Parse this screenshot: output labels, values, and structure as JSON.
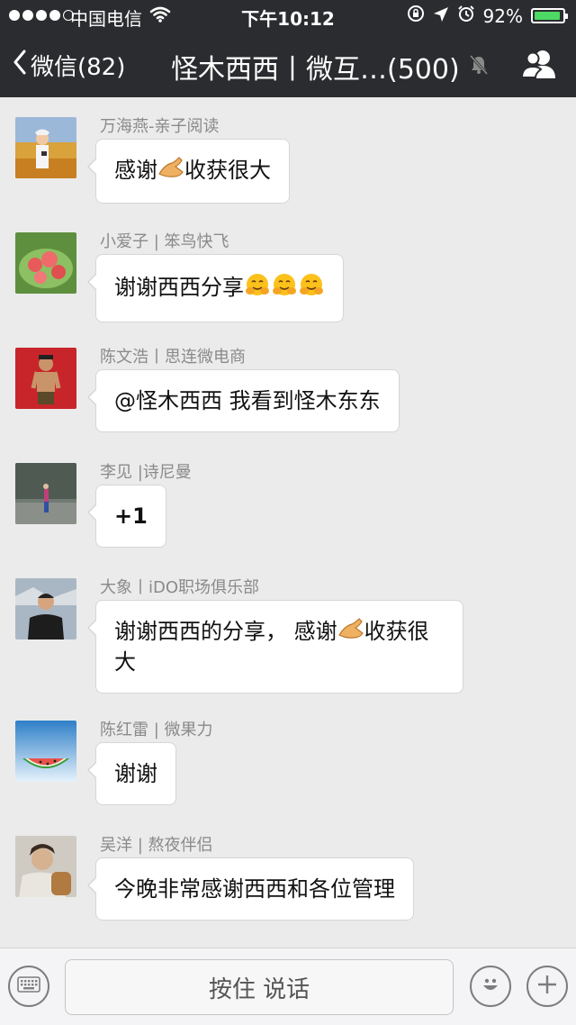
{
  "status_bar": {
    "carrier": "中国电信",
    "time": "下午10:12",
    "battery": "92%",
    "battery_fraction": 0.92
  },
  "nav": {
    "back_label": "微信(82)",
    "title": "怪木西西丨微互…(500)",
    "icons": {
      "back": "chevron-left-icon",
      "mute": "bell-muted-icon",
      "members": "group-members-icon"
    }
  },
  "messages": [
    {
      "sender": "万海燕-亲子阅读",
      "text_before": "感谢",
      "emoji": "ok-hand",
      "text_after": "收获很大"
    },
    {
      "sender": "小爱子 | 笨鸟快飞",
      "text": "谢谢西西分享",
      "emojis": [
        "hugging-face",
        "hugging-face",
        "hugging-face"
      ]
    },
    {
      "sender": "陈文浩丨思连微电商",
      "text": "@怪木西西 我看到怪木东东"
    },
    {
      "sender": "李见 |诗尼曼",
      "text": "+1"
    },
    {
      "sender": "大象丨iDO职场俱乐部",
      "text_before": "谢谢西西的分享， 感谢",
      "emoji": "ok-hand",
      "text_after": "收获很大"
    },
    {
      "sender": "陈红雷 | 微果力",
      "text": "谢谢"
    },
    {
      "sender": "吴洋 | 熬夜伴侣",
      "text": "今晚非常感谢西西和各位管理"
    }
  ],
  "input_bar": {
    "hold_to_talk": "按住 说话",
    "icons": {
      "keyboard": "keyboard-icon",
      "emoji": "smiley-icon",
      "more": "plus-icon"
    }
  },
  "colors": {
    "nav_background": "#2b2c2f",
    "chat_background": "#ebebeb",
    "bubble": "#ffffff",
    "battery_fill": "#4cd964"
  }
}
